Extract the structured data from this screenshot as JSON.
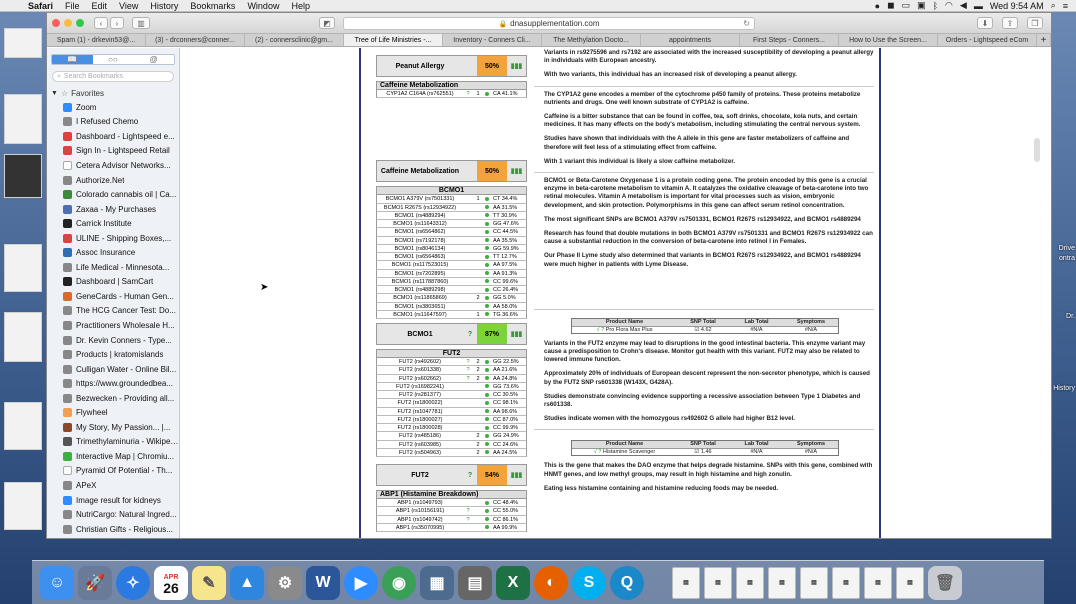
{
  "menubar": {
    "app": "Safari",
    "menus": [
      "File",
      "Edit",
      "View",
      "History",
      "Bookmarks",
      "Window",
      "Help"
    ],
    "clock": "Wed 9:54 AM"
  },
  "browser": {
    "url": "dnasupplementation.com",
    "tabs": [
      "Spam (1) - drkevin53@...",
      "(3) - drconners@conner...",
      "(2) - connersclinic@gm...",
      "Tree of Life Ministries -...",
      "Inventory - Conners Cli...",
      "The Methylation Docto...",
      "appointments",
      "First Steps - Conners...",
      "How to Use the Screen...",
      "Orders - Lightspeed eCom"
    ],
    "active_tab": 3
  },
  "sidebar": {
    "search_placeholder": "Search Bookmarks",
    "favorites_label": "Favorites",
    "bookmarks": [
      {
        "label": "Zoom",
        "color": "#2d8cff"
      },
      {
        "label": "I Refused Chemo",
        "color": "#888888"
      },
      {
        "label": "Dashboard - Lightspeed e...",
        "color": "#e04040"
      },
      {
        "label": "Sign In - Lightspeed Retail",
        "color": "#e04040"
      },
      {
        "label": "Cetera Advisor Networks...",
        "color": "#ffffff"
      },
      {
        "label": "Authorize.Net",
        "color": "#888888"
      },
      {
        "label": "Colorado cannabis oil | Ca...",
        "color": "#3a8a3a"
      },
      {
        "label": "Zaxaa - My Purchases",
        "color": "#4a6fb5"
      },
      {
        "label": "Carrick Institute",
        "color": "#222222"
      },
      {
        "label": "ULINE - Shipping Boxes,...",
        "color": "#e04040"
      },
      {
        "label": "Assoc Insurance",
        "color": "#2d6fb5"
      },
      {
        "label": "Life Medical - Minnesota...",
        "color": "#888888"
      },
      {
        "label": "Dashboard | SamCart",
        "color": "#222222"
      },
      {
        "label": "GeneCards - Human Gen...",
        "color": "#d86a2a"
      },
      {
        "label": "The HCG Cancer Test: Do...",
        "color": "#888888"
      },
      {
        "label": "Practitioners Wholesale H...",
        "color": "#888888"
      },
      {
        "label": "Dr. Kevin Conners - Type...",
        "color": "#888888"
      },
      {
        "label": "Products | kratomislands",
        "color": "#888888"
      },
      {
        "label": "Culligan Water - Online Bil...",
        "color": "#888888"
      },
      {
        "label": "https://www.groundedbea...",
        "color": "#888888"
      },
      {
        "label": "Bezwecken - Providing all...",
        "color": "#888888"
      },
      {
        "label": "Flywheel",
        "color": "#f0a050"
      },
      {
        "label": "My Story, My Passion... |...",
        "color": "#8a4a2a"
      },
      {
        "label": "Trimethylaminuria - Wikipedia",
        "color": "#555555"
      },
      {
        "label": "Interactive Map | Chromiu...",
        "color": "#3cb043"
      },
      {
        "label": "Pyramid Of Potential - Th...",
        "color": "#ffffff"
      },
      {
        "label": "APeX",
        "color": "#888888"
      },
      {
        "label": "Image result for kidneys",
        "color": "#2d8cff"
      },
      {
        "label": "NutriCargo: Natural Ingred...",
        "color": "#888888"
      },
      {
        "label": "Christian Gifts - Religious...",
        "color": "#888888"
      }
    ]
  },
  "report": {
    "peanut": {
      "name": "Peanut Allergy",
      "pct": "50%"
    },
    "caffeine_table": {
      "header": "Caffeine Metabolization",
      "rows": [
        {
          "snp": "CYP1A2 C164A (rs762551)",
          "q": "?",
          "v": "1",
          "g": "CA 41.1%"
        }
      ]
    },
    "caffeine": {
      "name": "Caffeine Metabolization",
      "pct": "50%"
    },
    "bcmo1_table": {
      "header": "BCMO1",
      "rows": [
        {
          "snp": "BCMO1 A379V (rs7501331)",
          "q": "",
          "v": "1",
          "g": "CT 34.4%"
        },
        {
          "snp": "BCMO1 R267S (rs12934922)",
          "q": "",
          "v": "",
          "g": "AA 31.5%"
        },
        {
          "snp": "BCMO1 (rs4889294)",
          "q": "",
          "v": "",
          "g": "TT 30.9%"
        },
        {
          "snp": "BCMO1 (rs11643312)",
          "q": "",
          "v": "",
          "g": "GG 47.6%"
        },
        {
          "snp": "BCMO1 (rs6564862)",
          "q": "",
          "v": "",
          "g": "CC 44.5%"
        },
        {
          "snp": "BCMO1 (rs7192178)",
          "q": "",
          "v": "",
          "g": "AA 35.5%"
        },
        {
          "snp": "BCMO1 (rs8046134)",
          "q": "",
          "v": "",
          "g": "GG 59.9%"
        },
        {
          "snp": "BCMO1 (rs6564863)",
          "q": "",
          "v": "",
          "g": "TT 12.7%"
        },
        {
          "snp": "BCMO1 (rs117523015)",
          "q": "",
          "v": "",
          "g": "AA 97.5%"
        },
        {
          "snp": "BCMO1 (rs7202895)",
          "q": "",
          "v": "",
          "g": "AA 91.3%"
        },
        {
          "snp": "BCMO1 (rs117887860)",
          "q": "",
          "v": "",
          "g": "CC 99.6%"
        },
        {
          "snp": "BCMO1 (rs4889298)",
          "q": "",
          "v": "",
          "g": "CC 26.4%"
        },
        {
          "snp": "BCMO1 (rs11865869)",
          "q": "",
          "v": "2",
          "g": "GG 5.0%"
        },
        {
          "snp": "BCMO1 (rs3803651)",
          "q": "",
          "v": "",
          "g": "AA 58.0%"
        },
        {
          "snp": "BCMO1 (rs11647597)",
          "q": "",
          "v": "1",
          "g": "TG 36.6%"
        }
      ]
    },
    "bcmo1": {
      "name": "BCMO1",
      "q": "?",
      "pct": "87%"
    },
    "fut2_table": {
      "header": "FUT2",
      "rows": [
        {
          "snp": "FUT2 (rs492602)",
          "q": "?",
          "v": "2",
          "g": "GG 22.5%"
        },
        {
          "snp": "FUT2 (rs601338)",
          "q": "?",
          "v": "2",
          "g": "AA 21.6%"
        },
        {
          "snp": "FUT2 (rs602662)",
          "q": "?",
          "v": "2",
          "g": "AA 24.8%"
        },
        {
          "snp": "FUT2 (rs16982241)",
          "q": "",
          "v": "",
          "g": "GG 73.6%"
        },
        {
          "snp": "FUT2 (rs281377)",
          "q": "",
          "v": "",
          "g": "CC 30.5%"
        },
        {
          "snp": "FUT2 (rs1800022)",
          "q": "",
          "v": "",
          "g": "CC 98.1%"
        },
        {
          "snp": "FUT2 (rs1047781)",
          "q": "",
          "v": "",
          "g": "AA 98.6%"
        },
        {
          "snp": "FUT2 (rs1800027)",
          "q": "",
          "v": "",
          "g": "CC 87.0%"
        },
        {
          "snp": "FUT2 (rs1800028)",
          "q": "",
          "v": "",
          "g": "CC 99.9%"
        },
        {
          "snp": "FUT2 (rs485186)",
          "q": "",
          "v": "2",
          "g": "GG 24.9%"
        },
        {
          "snp": "FUT2 (rs603985)",
          "q": "",
          "v": "2",
          "g": "CC 24.6%"
        },
        {
          "snp": "FUT2 (rs504963)",
          "q": "",
          "v": "2",
          "g": "AA 24.5%"
        }
      ]
    },
    "fut2": {
      "name": "FUT2",
      "q": "?",
      "pct": "54%"
    },
    "abp1_table": {
      "header": "ABP1 (Histamine Breakdown)",
      "rows": [
        {
          "snp": "ABP1 (rs1049793)",
          "q": "",
          "v": "",
          "g": "CC 48.4%"
        },
        {
          "snp": "ABP1 (rs10156191)",
          "q": "?",
          "v": "",
          "g": "CC 55.0%"
        },
        {
          "snp": "ABP1 (rs1049742)",
          "q": "?",
          "v": "",
          "g": "CC 86.1%"
        },
        {
          "snp": "ABP1 (rs35070995)",
          "q": "",
          "v": "",
          "g": "AA 99.9%"
        }
      ]
    },
    "colors": {
      "orange": "#f3a33c",
      "green": "#7dd33a",
      "chart_green": "#3cb043"
    },
    "right": {
      "peanut_p1": "Variants in rs9275596 and rs7192 are associated with the increased susceptibility of developing a peanut allergy in individuals with European ancestry.",
      "peanut_p2": "With two variants, this individual has an increased risk of developing a peanut allergy.",
      "caffeine_p1": "The CYP1A2 gene encodes a member of the cytochrome p450 family of proteins. These proteins metabolize nutrients and drugs. One well known substrate of CYP1A2 is caffeine.",
      "caffeine_p2": "Caffeine is a bitter substance that can be found in coffee, tea, soft drinks, chocolate, kola nuts, and certain medicines. It has many effects on the body's metabolism, including stimulating the central nervous system.",
      "caffeine_p3": "Studies have shown that individuals with the A allele in this gene are faster metabolizers of caffeine and therefore will feel less of a stimulating effect from caffeine.",
      "caffeine_p4": "With 1 variant this individual is likely a slow caffeine metabolizer.",
      "bcmo1_p1": "BCMO1 or Beta-Carotene Oxygenase 1 is a protein coding gene. The protein encoded by this gene is a crucial enzyme in beta-carotene metabolism to vitamin A. It catalyzes the oxidative cleavage of beta-carotene into two retinal molecules. Vitamin A metabolism is important for vital processes such as vision, embryonic development, and skin protection. Polymorphisms in this gene can affect serum retinol concentration.",
      "bcmo1_p2": "The most significant SNPs are BCMO1 A379V rs7501331, BCMO1 R267S rs12934922, and BCMO1 rs4889294",
      "bcmo1_p3": "Research has found that double mutations in both BCMO1 A379V rs7501331 and BCMO1 R267S rs12934922 can cause a substantial reduction in the conversion of beta-carotene into retinol I in Females.",
      "bcmo1_p4": "Our Phase II Lyme study also determined that variants in BCMO1 R267S rs12934922, and BCMO1 rs4889294 were much higher in patients with Lyme Disease.",
      "ptable_headers": [
        "Product Name",
        "SNP Total",
        "Lab Total",
        "Symptoms"
      ],
      "fut2_product": {
        "name": "Pro Flora Max Plus",
        "snp": "4.62",
        "lab": "#N/A",
        "sym": "#N/A"
      },
      "fut2_p1": "Variants in the FUT2 enzyme may lead to disruptions in the good intestinal bacteria. This enzyme variant may cause a predisposition to Crohn's disease. Monitor gut health with this variant. FUT2 may also be related to lowered immune function.",
      "fut2_p2": "Approximately 20% of individuals of European descent represent the non-secretor phenotype, which is caused by the FUT2 SNP rs601338 (W143X, G428A).",
      "fut2_p3": "Studies demonstrate convincing evidence supporting a recessive association between Type 1 Diabetes and rs601338.",
      "fut2_p4": "Studies indicate women with the homozygous rs492602 G allele had higher B12 level.",
      "abp1_product": {
        "name": "Histamine Scavenger",
        "snp": "1.46",
        "lab": "#N/A",
        "sym": "#N/A"
      },
      "abp1_p1": "This is the gene that makes the DAO enzyme that helps degrade histamine. SNPs with this gene, combined with HNMT genes, and low methyl groups, may result in high histamine and high zonulin.",
      "abp1_p2": "Eating less histamine containing and histamine reducing foods may be needed."
    }
  },
  "desktop_right_labels": [
    "Drive",
    "ontra",
    "Dr.",
    "History"
  ],
  "dock_date": {
    "month": "APR",
    "day": "26"
  }
}
